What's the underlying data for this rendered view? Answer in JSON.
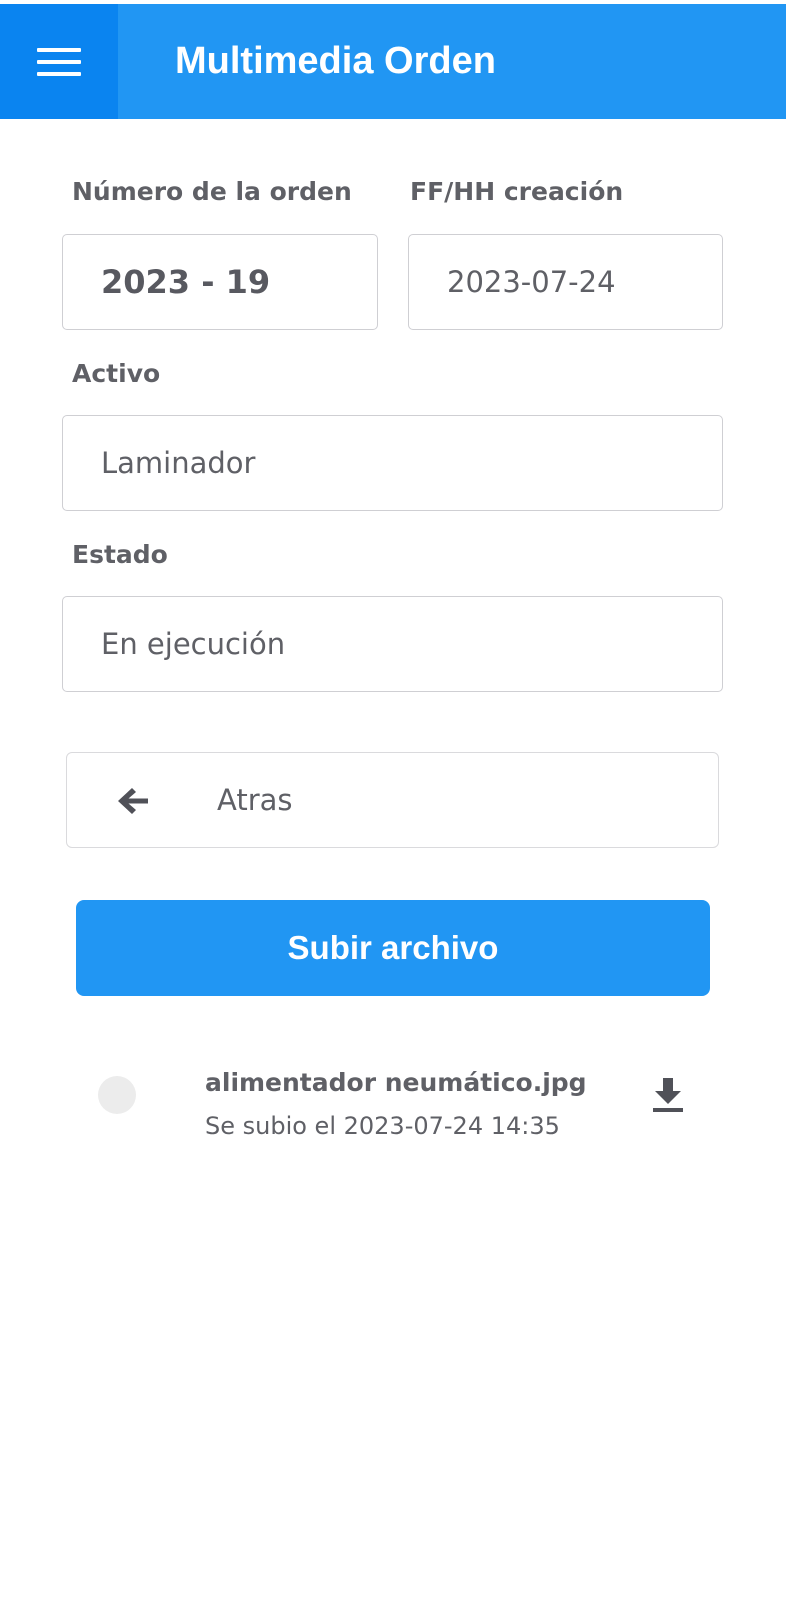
{
  "header": {
    "title": "Multimedia Orden",
    "menu_icon": "hamburger-menu-icon"
  },
  "form": {
    "order_number": {
      "label": "Número de la orden",
      "value": "2023 - 19"
    },
    "created": {
      "label": "FF/HH creación",
      "value": "2023-07-24"
    },
    "asset": {
      "label": "Activo",
      "value": "Laminador"
    },
    "status": {
      "label": "Estado",
      "value": "En ejecución"
    }
  },
  "back_button": {
    "label": "Atras",
    "icon": "arrow-left-icon"
  },
  "upload_button": {
    "label": "Subir archivo"
  },
  "files": [
    {
      "name": "alimentador neumático.jpg",
      "uploaded": "Se subio el 2023-07-24 14:35",
      "action_icon": "download-icon"
    }
  ],
  "colors": {
    "primary": "#2196f3",
    "primary_dark": "#0a84f0",
    "text": "#5f6066",
    "border": "#cfcfd3"
  }
}
